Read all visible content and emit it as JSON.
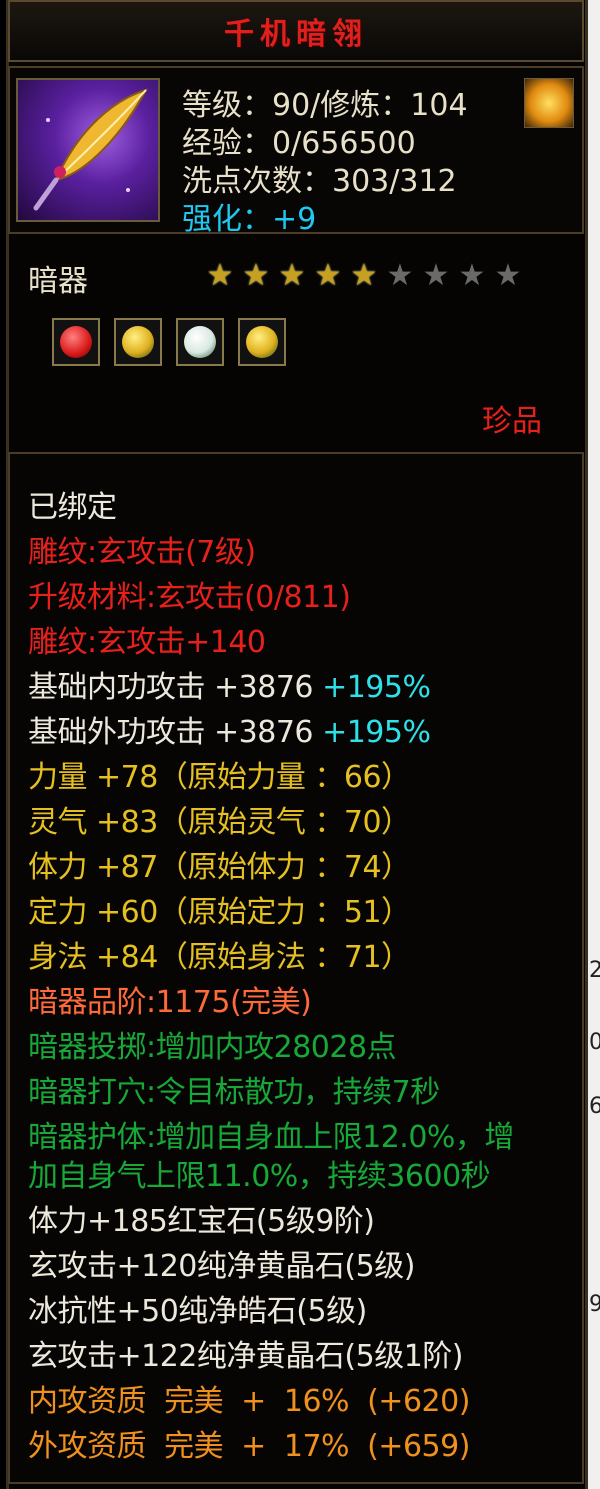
{
  "title": "千机暗翎",
  "header": {
    "level": "等级：90/修炼：104",
    "exp": "经验：0/656500",
    "reset_count": "洗点次数：303/312",
    "enhance": "强化：+9"
  },
  "type_label": "暗器",
  "stars": {
    "filled": 5,
    "total": 9
  },
  "gems": [
    {
      "name": "red-gem-icon",
      "color": "#d81818"
    },
    {
      "name": "yellow-gem-icon",
      "color": "#e0b020"
    },
    {
      "name": "white-gem-icon",
      "color": "#d8e8e0"
    },
    {
      "name": "yellow-gem-icon",
      "color": "#e0b020"
    }
  ],
  "rarity": "珍品",
  "details": {
    "bound": "已绑定",
    "carving1": "雕纹:玄攻击(7级)",
    "upgrade_material": "升级材料:玄攻击(0/811)",
    "carving2": "雕纹:玄攻击+140",
    "inner_attack": "基础内功攻击 +3876",
    "inner_attack_pct": "+195%",
    "outer_attack": "基础外功攻击 +3876",
    "outer_attack_pct": "+195%",
    "strength": "力量 +78（原始力量 ：66）",
    "spirit": "灵气 +83（原始灵气 ：70）",
    "stamina": "体力 +87（原始体力 ：74）",
    "focus": "定力 +60（原始定力 ：51）",
    "agility": "身法 +84（原始身法 ：71）",
    "grade": "暗器品阶:1175(完美)",
    "throw": "暗器投掷:增加内攻28028点",
    "acupoint": "暗器打穴:令目标散功，持续7秒",
    "guard1": "暗器护体:增加自身血上限12.0%，增",
    "guard2": "加自身气上限11.0%，持续3600秒",
    "gem1": "体力+185红宝石(5级9阶)",
    "gem2": "玄攻击+120纯净黄晶石(5级)",
    "gem3": "冰抗性+50纯净皓石(5级)",
    "gem4": "玄攻击+122纯净黄晶石(5级1阶)",
    "inner_quality": "内攻资质  完美  +  16%  (+620)",
    "outer_quality": "外攻资质  完美  +  17%  (+659)"
  },
  "right_strip": [
    "2",
    "0",
    "6",
    "9"
  ]
}
